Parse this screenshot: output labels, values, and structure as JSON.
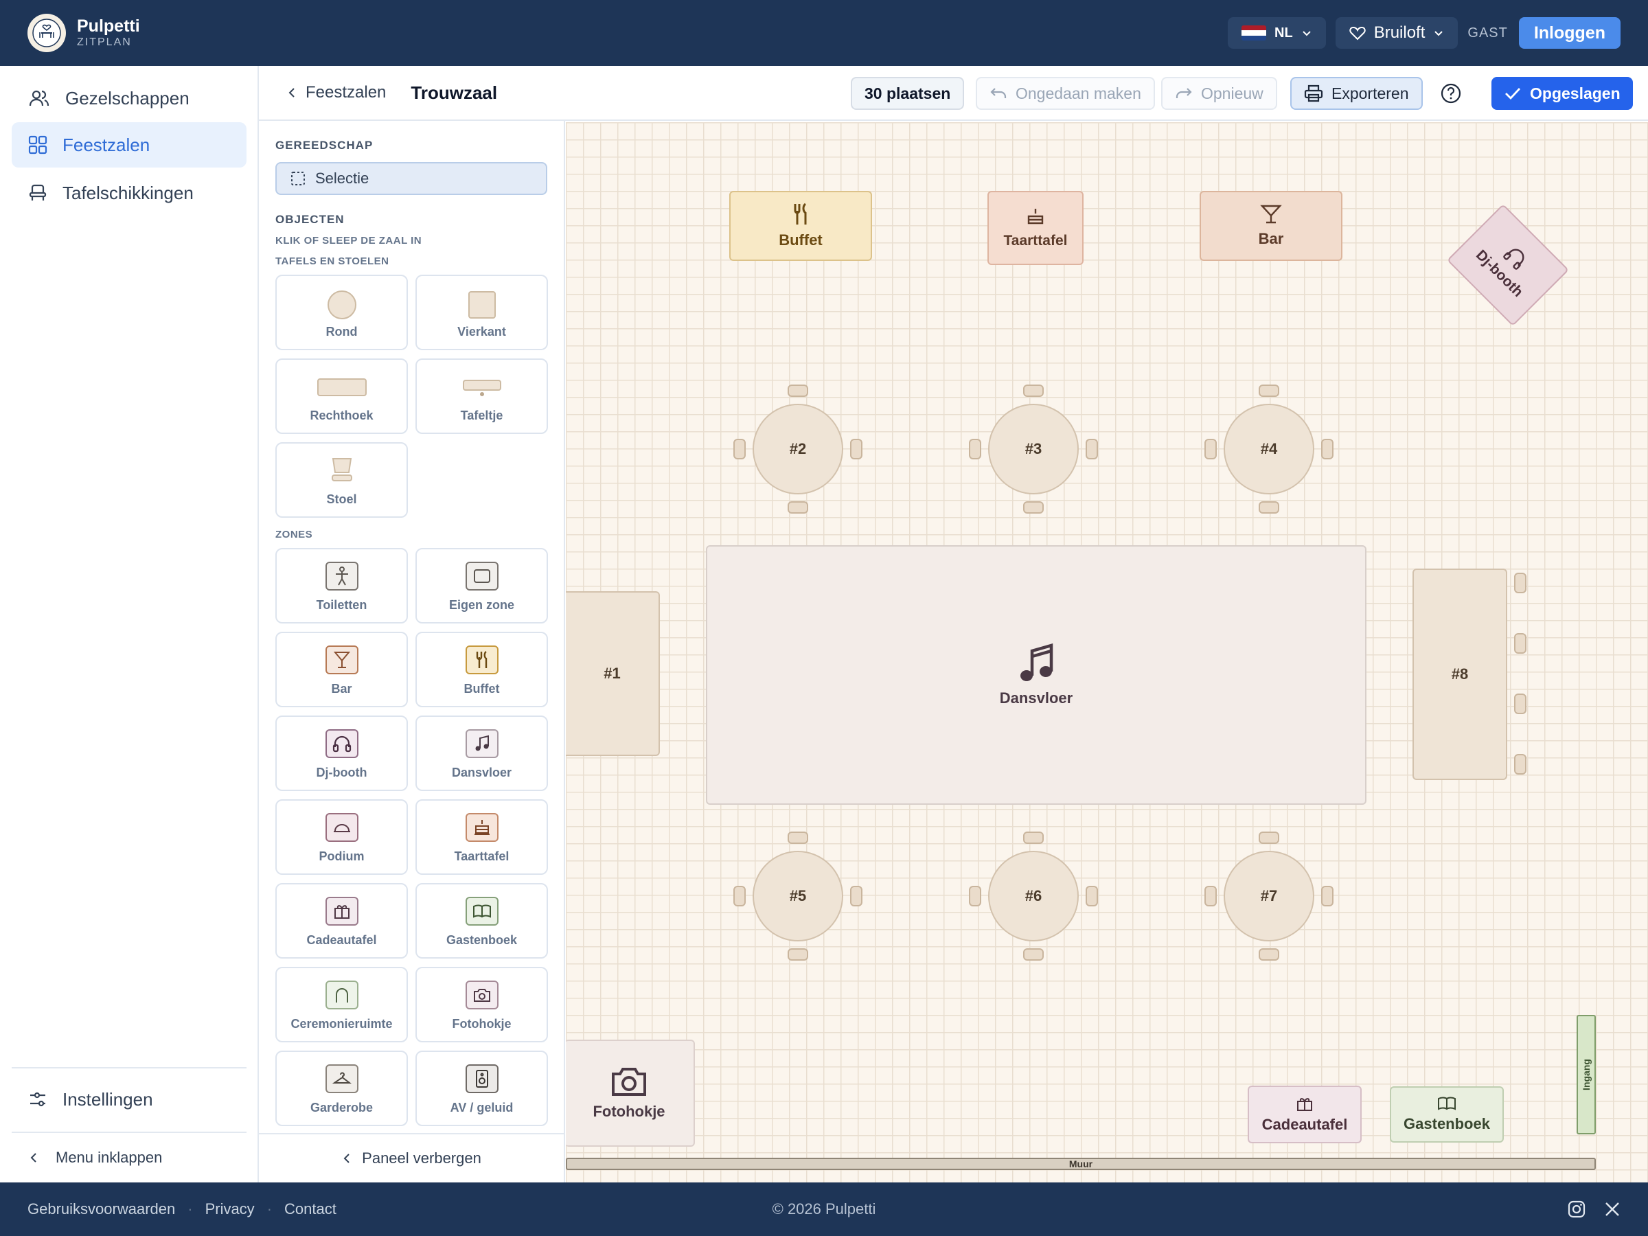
{
  "header": {
    "brand": "Pulpetti",
    "subtitle": "ZITPLAN",
    "language": "NL",
    "event": "Bruiloft",
    "role": "GAST",
    "login": "Inloggen"
  },
  "sidebar": {
    "items": [
      {
        "label": "Gezelschappen",
        "icon": "users-icon",
        "active": false
      },
      {
        "label": "Feestzalen",
        "icon": "grid-icon",
        "active": true
      },
      {
        "label": "Tafelschikkingen",
        "icon": "chair-icon",
        "active": false
      }
    ],
    "settings": "Instellingen",
    "collapse": "Menu inklappen"
  },
  "toolbar": {
    "back": "Feestzalen",
    "title": "Trouwzaal",
    "seats": "30 plaatsen",
    "undo": "Ongedaan maken",
    "redo": "Opnieuw",
    "export": "Exporteren",
    "saved": "Opgeslagen"
  },
  "panel": {
    "tools_header": "GEREEDSCHAP",
    "selection": "Selectie",
    "objects_header": "OBJECTEN",
    "objects_hint": "KLIK OF SLEEP DE ZAAL IN",
    "tables_header": "TAFELS EN STOELEN",
    "tables": [
      "Rond",
      "Vierkant",
      "Rechthoek",
      "Tafeltje",
      "Stoel"
    ],
    "zones_header": "ZONES",
    "zones": [
      "Toiletten",
      "Eigen zone",
      "Bar",
      "Buffet",
      "Dj-booth",
      "Dansvloer",
      "Podium",
      "Taarttafel",
      "Cadeautafel",
      "Gastenboek",
      "Ceremonieruimte",
      "Fotohokje",
      "Garderobe",
      "AV / geluid"
    ],
    "hide": "Paneel verbergen"
  },
  "canvas": {
    "zones": {
      "buffet": "Buffet",
      "cake": "Taarttafel",
      "bar": "Bar",
      "dj": "Dj-booth",
      "dance": "Dansvloer",
      "photo": "Fotohokje",
      "gifts": "Cadeautafel",
      "guestbook": "Gastenboek",
      "entrance": "Ingang",
      "wall": "Muur"
    },
    "tables": [
      "#1",
      "#2",
      "#3",
      "#4",
      "#5",
      "#6",
      "#7",
      "#8"
    ]
  },
  "footer": {
    "links": [
      "Gebruiksvoorwaarden",
      "Privacy",
      "Contact"
    ],
    "copyright": "© 2026 Pulpetti"
  },
  "colors": {
    "header_bg": "#1e3557",
    "primary": "#2563eb",
    "canvas_bg": "#fbf5ed"
  }
}
